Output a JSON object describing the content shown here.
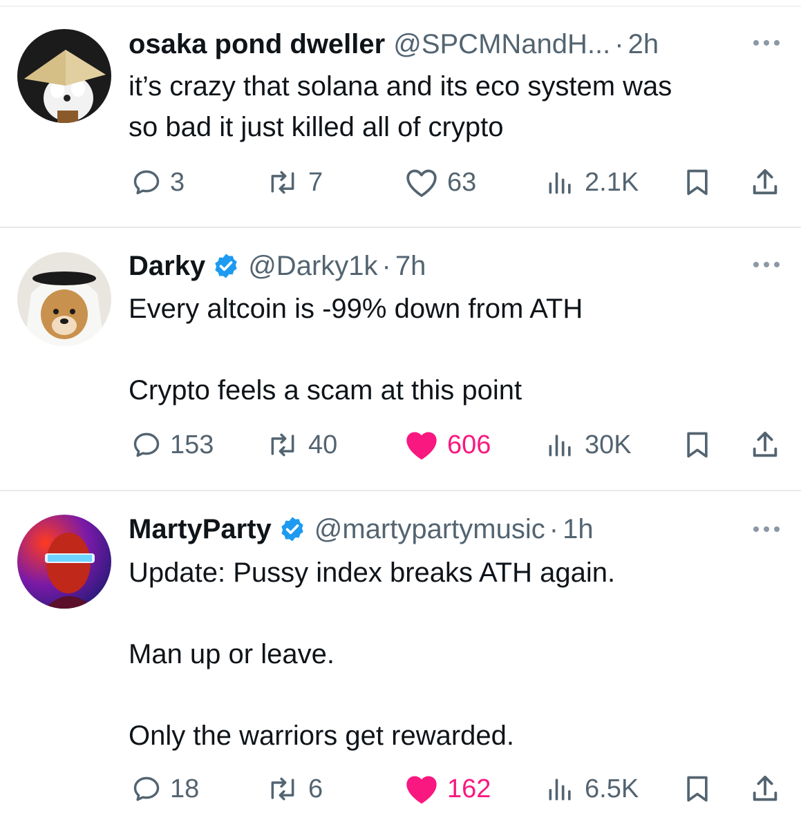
{
  "tweets": [
    {
      "name": "osaka pond dweller",
      "verified": false,
      "handle": "@SPCMNandH...",
      "time": "2h",
      "dot": "·",
      "lines": [
        "it’s crazy that solana and its eco system was",
        "so bad it just killed all of crypto"
      ],
      "replies": "3",
      "reposts": "7",
      "likes": "63",
      "liked": false,
      "views": "2.1K"
    },
    {
      "name": "Darky",
      "verified": true,
      "handle": "@Darky1k",
      "time": "7h",
      "dot": "·",
      "lines": [
        "Every altcoin is -99% down from ATH",
        "",
        "Crypto feels a scam at this point"
      ],
      "replies": "153",
      "reposts": "40",
      "likes": "606",
      "liked": true,
      "views": "30K"
    },
    {
      "name": "MartyParty",
      "verified": true,
      "handle": "@martypartymusic",
      "time": "1h",
      "dot": "·",
      "lines": [
        "Update: Pussy index breaks ATH again.",
        "",
        "Man up or leave.",
        "",
        "Only the warriors get rewarded."
      ],
      "replies": "18",
      "reposts": "6",
      "likes": "162",
      "liked": true,
      "views": "6.5K"
    }
  ],
  "colors": {
    "text": "#0f1419",
    "muted": "#536471",
    "like": "#f91880",
    "verified": "#1d9bf0"
  },
  "icons": {
    "reply": "speech-bubble-icon",
    "repost": "repost-arrows-icon",
    "like": "heart-icon",
    "views": "bar-chart-icon",
    "bookmark": "bookmark-icon",
    "share": "share-upload-icon",
    "more": "more-dots-icon",
    "verified": "verified-badge-icon"
  }
}
